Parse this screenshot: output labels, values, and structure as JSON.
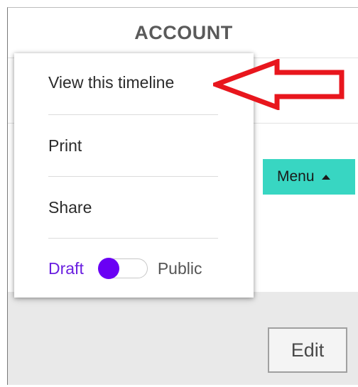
{
  "header": {
    "title": "ACCOUNT"
  },
  "menu_button": {
    "label": "Menu",
    "icon": "caret-up-icon"
  },
  "edit_button": {
    "label": "Edit"
  },
  "dropdown": {
    "items": [
      {
        "label": "View this timeline"
      },
      {
        "label": "Print"
      },
      {
        "label": "Share"
      }
    ],
    "visibility_toggle": {
      "left_label": "Draft",
      "right_label": "Public",
      "state": "Draft"
    }
  },
  "annotation": {
    "icon": "red-arrow-icon",
    "color": "#e8161d"
  },
  "colors": {
    "menu_button_bg": "#38d6c2",
    "toggle_accent": "#6a00f4",
    "draft_text": "#6a1fe0"
  }
}
